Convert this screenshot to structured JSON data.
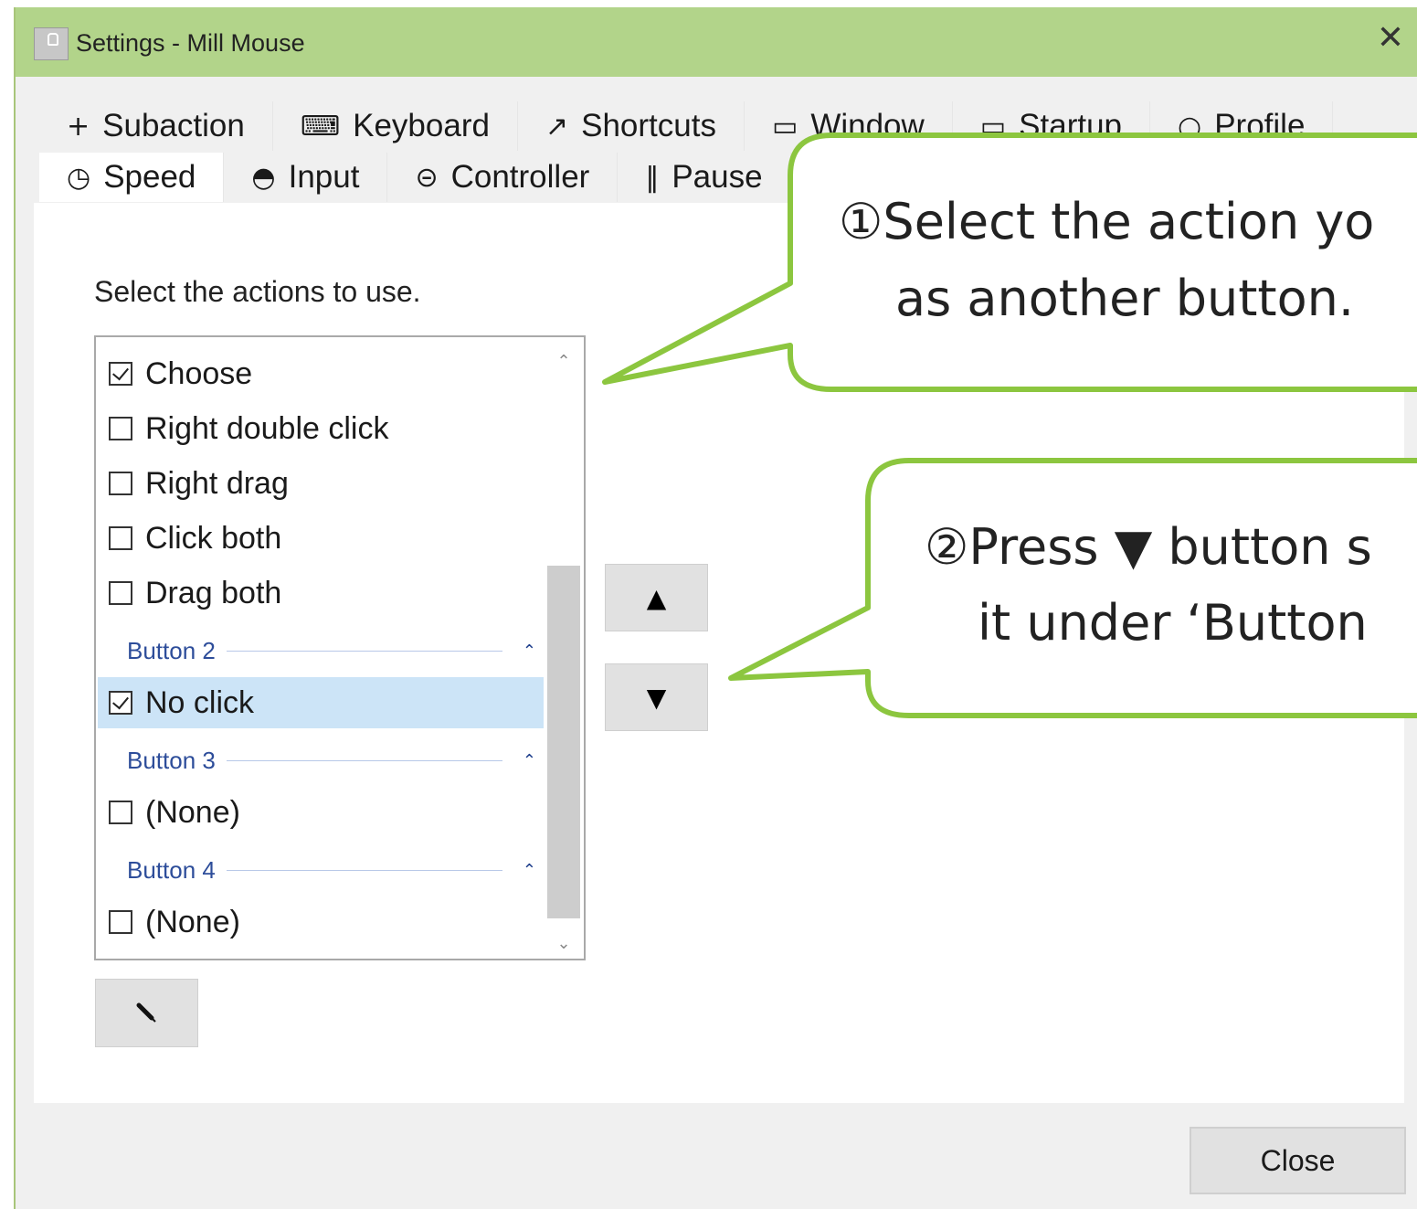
{
  "window": {
    "title": "Settings - Mill Mouse",
    "close_glyph": "✕"
  },
  "tabs": {
    "row1": [
      {
        "icon": "plus-icon",
        "glyph": "+",
        "label": "Subaction"
      },
      {
        "icon": "keyboard-icon",
        "glyph": "⌨",
        "label": "Keyboard"
      },
      {
        "icon": "arrow-diagonal-icon",
        "glyph": "↗",
        "label": "Shortcuts"
      },
      {
        "icon": "window-icon",
        "glyph": "▭",
        "label": "Window"
      },
      {
        "icon": "monitor-icon",
        "glyph": "▭",
        "label": "Startup"
      },
      {
        "icon": "person-icon",
        "glyph": "○",
        "label": "Profile"
      }
    ],
    "row2": [
      {
        "icon": "clock-icon",
        "glyph": "◷",
        "label": "Speed",
        "active": true
      },
      {
        "icon": "eye-icon",
        "glyph": "◓",
        "label": "Input"
      },
      {
        "icon": "gamepad-icon",
        "glyph": "⊝",
        "label": "Controller"
      },
      {
        "icon": "pause-icon",
        "glyph": "‖",
        "label": "Pause"
      }
    ]
  },
  "main": {
    "instruction": "Select the actions to use."
  },
  "actions_list": {
    "items": [
      {
        "type": "item",
        "label": "Choose",
        "checked": true
      },
      {
        "type": "item",
        "label": "Right double click",
        "checked": false
      },
      {
        "type": "item",
        "label": "Right drag",
        "checked": false
      },
      {
        "type": "item",
        "label": "Click both",
        "checked": false
      },
      {
        "type": "item",
        "label": "Drag both",
        "checked": false
      },
      {
        "type": "group",
        "label": "Button 2"
      },
      {
        "type": "item",
        "label": "No click",
        "checked": true,
        "selected": true
      },
      {
        "type": "group",
        "label": "Button 3"
      },
      {
        "type": "item",
        "label": "(None)",
        "checked": false
      },
      {
        "type": "group",
        "label": "Button 4"
      },
      {
        "type": "item",
        "label": "(None)",
        "checked": false
      }
    ]
  },
  "buttons": {
    "move_up": "▲",
    "move_down": "▼",
    "close": "Close"
  },
  "callouts": {
    "first_line1": "①Select the action yo",
    "first_line2": "as another button.",
    "second_line1": "②Press ▼ button s",
    "second_line2": "it under ‘Button"
  },
  "colors": {
    "titlebar": "#b2d48a",
    "callout_border": "#8cc63f",
    "selection": "#cce4f7",
    "group_text": "#2d4d9a"
  }
}
